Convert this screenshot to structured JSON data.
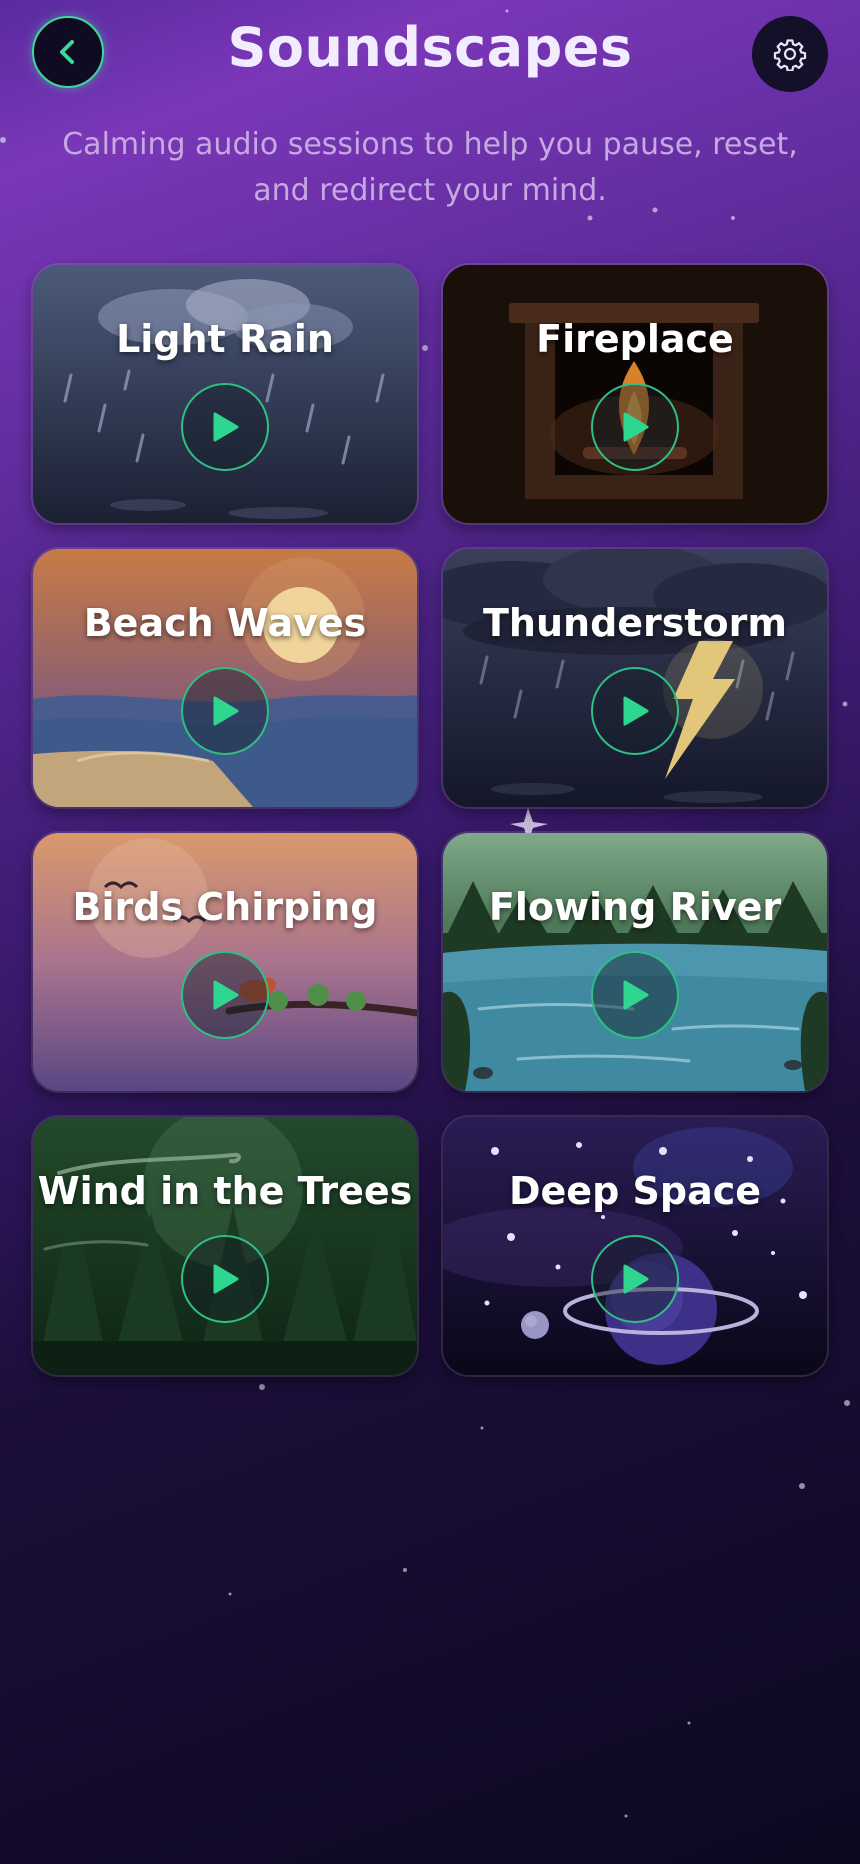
{
  "header": {
    "title": "Soundscapes",
    "back_icon": "chevron-left-icon",
    "settings_icon": "gear-icon"
  },
  "subtitle": "Calming audio sessions to help you pause, reset, and redirect your mind.",
  "colors": {
    "accent": "#3fd79a",
    "play": "#2fd68f"
  },
  "soundscapes": [
    {
      "title": "Light Rain",
      "icon": "play-icon"
    },
    {
      "title": "Fireplace",
      "icon": "play-icon"
    },
    {
      "title": "Beach Waves",
      "icon": "play-icon"
    },
    {
      "title": "Thunderstorm",
      "icon": "play-icon"
    },
    {
      "title": "Birds Chirping",
      "icon": "play-icon"
    },
    {
      "title": "Flowing River",
      "icon": "play-icon"
    },
    {
      "title": "Wind in the Trees",
      "icon": "play-icon"
    },
    {
      "title": "Deep Space",
      "icon": "play-icon"
    }
  ]
}
